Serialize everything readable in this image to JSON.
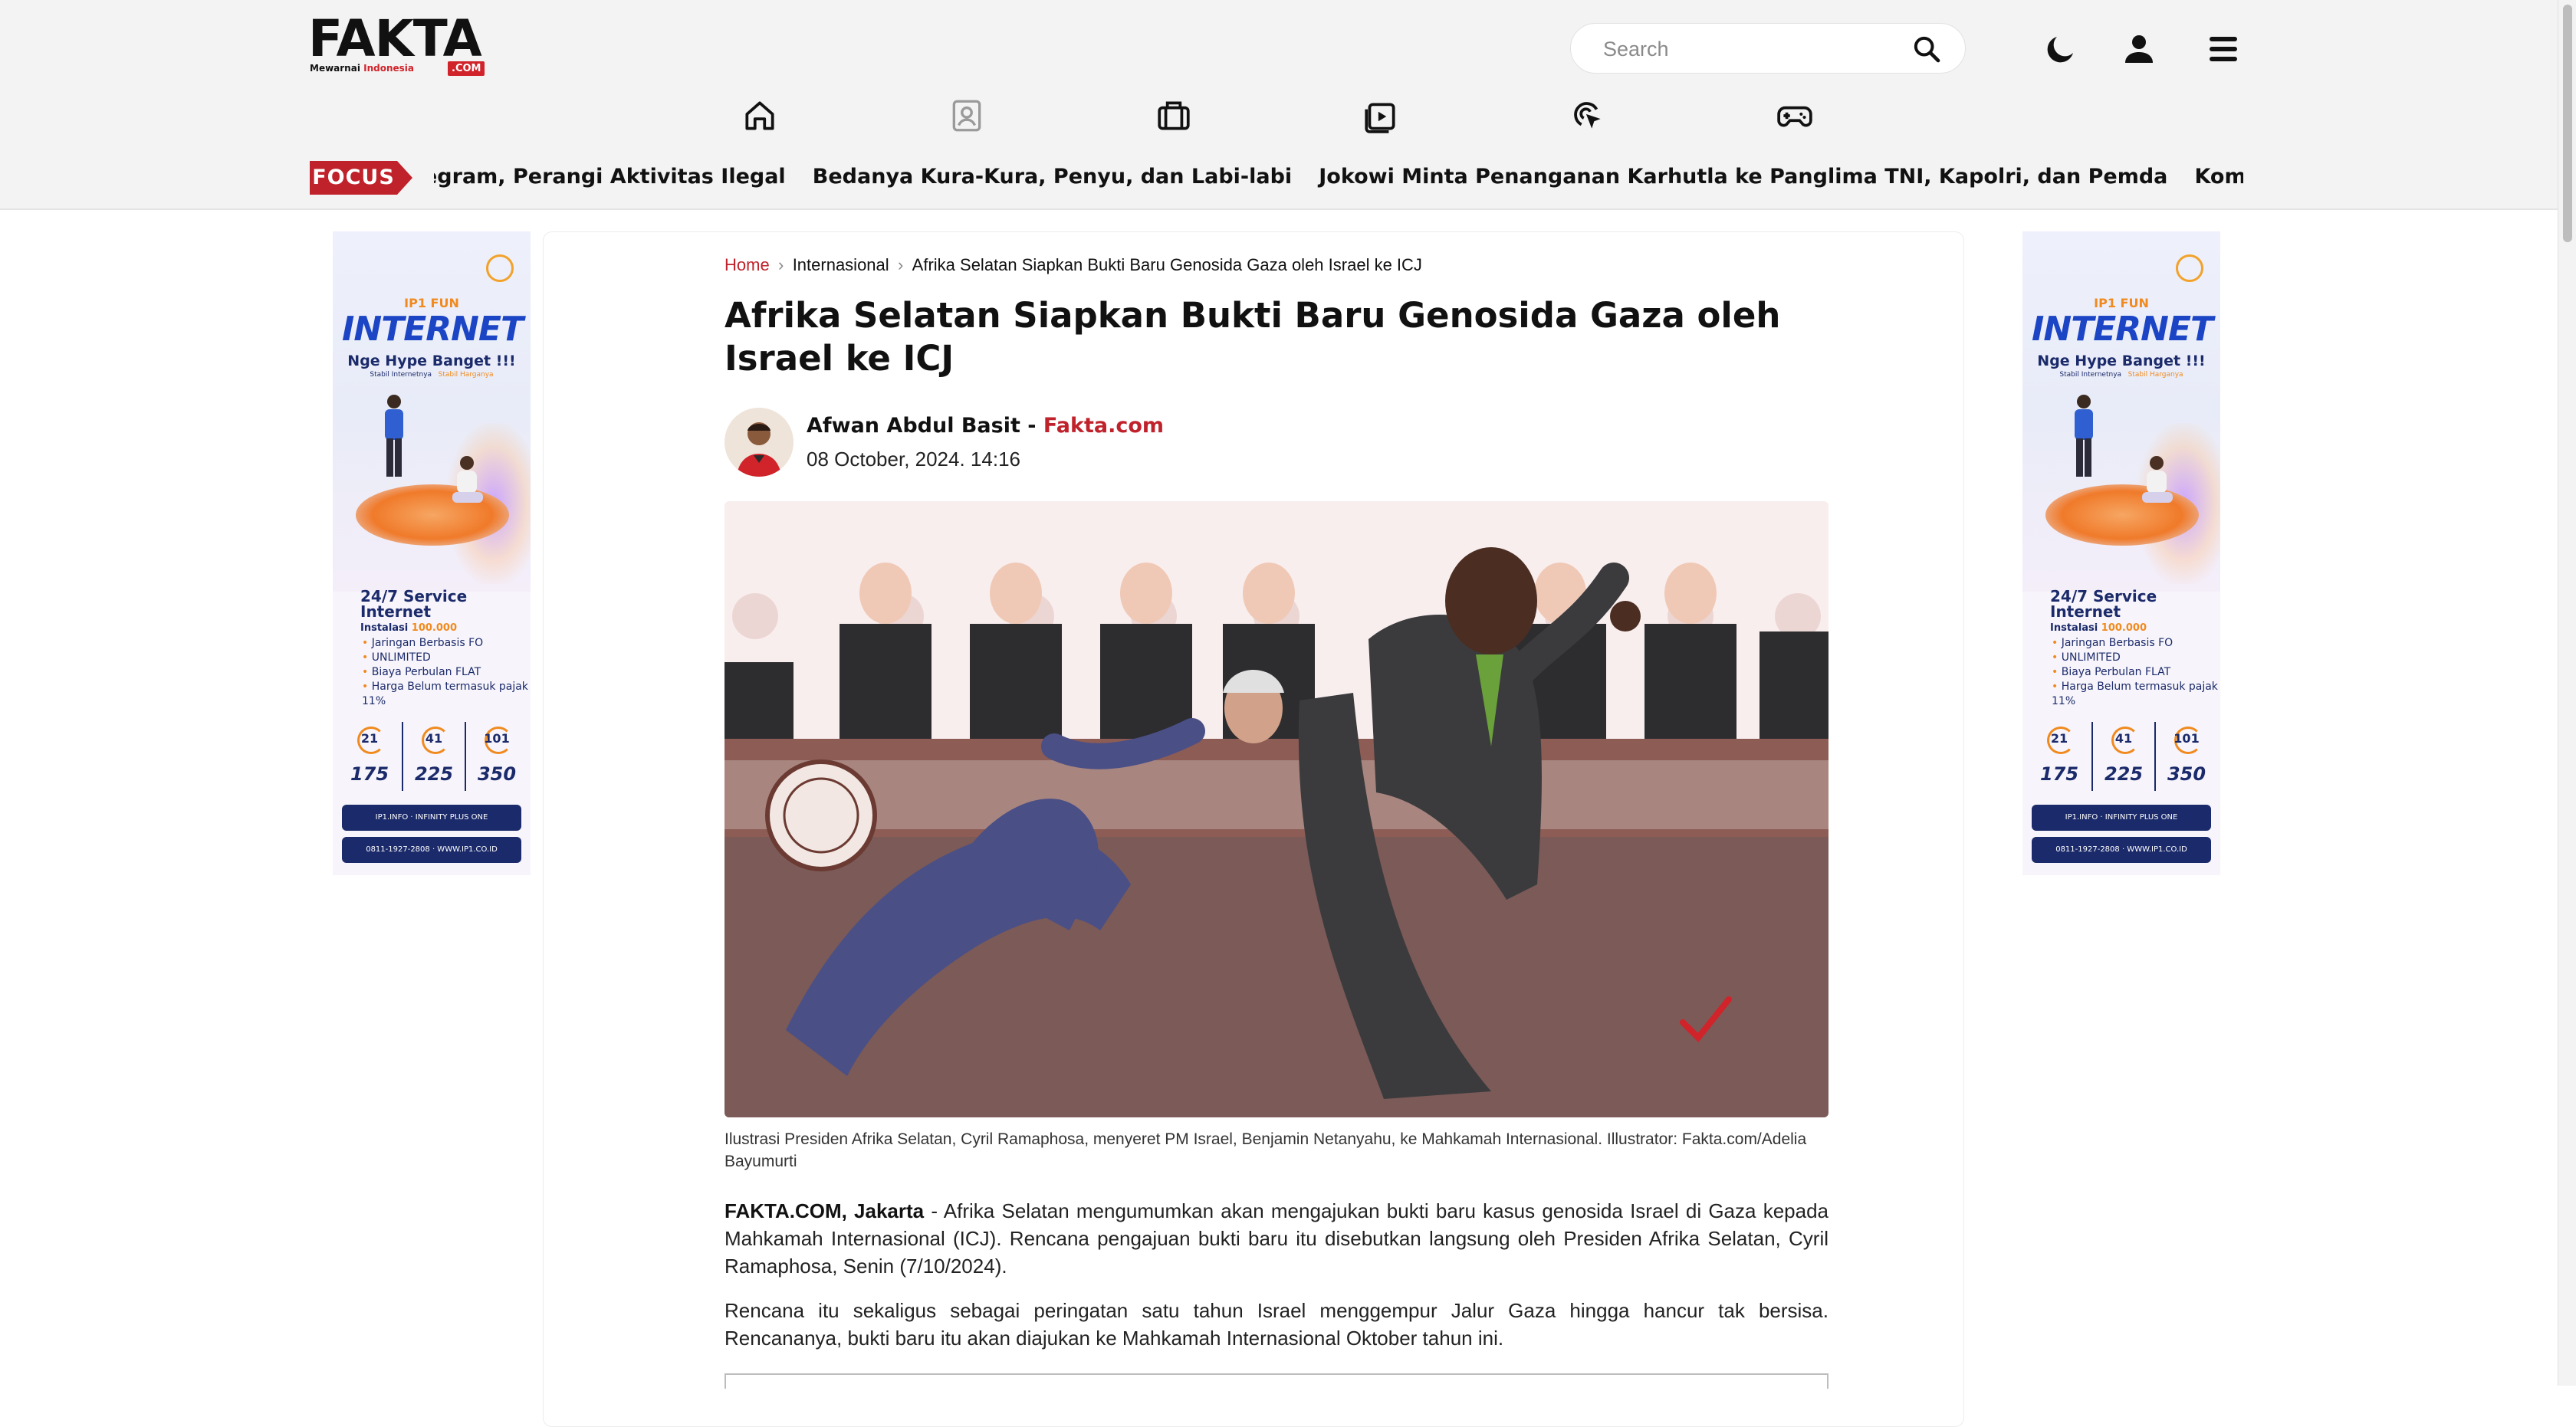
{
  "brand": {
    "logo_text": "FAKTA",
    "tagline_prefix": "Mewarnai",
    "tagline_accent": "Indonesia",
    "dotcom": ".COM",
    "accent_color": "#c0222b"
  },
  "header": {
    "search_placeholder": "Search",
    "icons": [
      "dark-mode-icon",
      "user-icon",
      "menu-icon"
    ]
  },
  "nav": {
    "icons": [
      "home-icon",
      "profile-card-icon",
      "briefcase-icon",
      "video-play-icon",
      "cursor-click-icon",
      "gamepad-icon"
    ]
  },
  "focus": {
    "label": "FOCUS",
    "items": [
      "egram, Perangi Aktivitas Ilegal",
      "Bedanya Kura-Kura, Penyu, dan Labi-labi",
      "Jokowi Minta Penanganan Karhutla ke Panglima TNI, Kapolri, dan Pemda",
      "Komentar Para Pesaing Ata"
    ]
  },
  "ad": {
    "fun": "IP1 FUN",
    "headline": "INTERNET",
    "hype": "Nge Hype Banget !!!",
    "stabil_a": "Stabil Internetnya",
    "stabil_b": "Stabil Harganya",
    "service": "24/7 Service",
    "service2": "Internet",
    "install_label": "Instalasi",
    "install_price": "100.000",
    "features": [
      "Jaringan Berbasis FO",
      "UNLIMITED",
      "Biaya Perbulan FLAT",
      "Harga Belum termasuk pajak 11%"
    ],
    "speeds": [
      {
        "mbps": "21",
        "price": "175"
      },
      {
        "mbps": "41",
        "price": "225"
      },
      {
        "mbps": "101",
        "price": "350"
      }
    ],
    "social": "IP1.INFO  ·  INFINITY PLUS ONE",
    "contact": "0811-1927-2808  ·  WWW.IP1.CO.ID"
  },
  "article": {
    "breadcrumb": [
      "Home",
      "Internasional",
      "Afrika Selatan Siapkan Bukti Baru Genosida Gaza oleh Israel ke ICJ"
    ],
    "title": "Afrika Selatan Siapkan Bukti Baru Genosida Gaza oleh Israel ke ICJ",
    "author": "Afwan Abdul Basit",
    "author_sep": " - ",
    "site": "Fakta.com",
    "date": "08 October, 2024. 14:16",
    "caption": "Ilustrasi Presiden Afrika Selatan, Cyril Ramaphosa, menyeret PM Israel, Benjamin Netanyahu, ke Mahkamah Internasional. Illustrator: Fakta.com/Adelia Bayumurti",
    "p1_lead": "FAKTA.COM, Jakarta",
    "p1_body": " - Afrika Selatan mengumumkan akan mengajukan bukti baru kasus genosida Israel di Gaza kepada Mahkamah Internasional (ICJ). Rencana pengajuan bukti baru itu disebutkan langsung oleh Presiden Afrika Selatan, Cyril Ramaphosa, Senin (7/10/2024).",
    "p2": "Rencana itu sekaligus sebagai peringatan satu tahun Israel menggempur Jalur Gaza hingga hancur tak bersisa. Rencananya, bukti baru itu akan diajukan ke Mahkamah Internasional Oktober tahun ini."
  }
}
